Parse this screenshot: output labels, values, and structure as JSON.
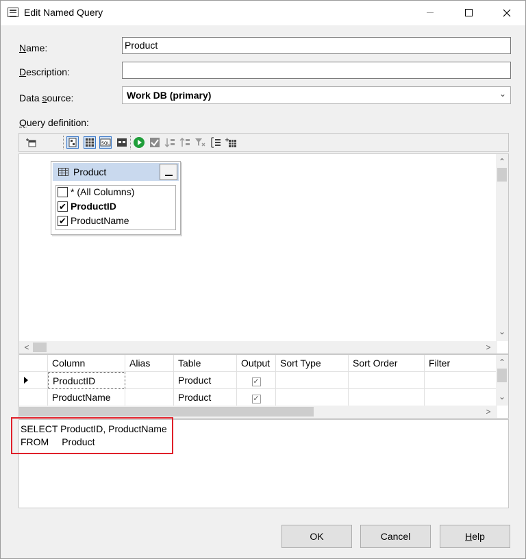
{
  "window": {
    "title": "Edit Named Query"
  },
  "form": {
    "name_label_accel": "N",
    "name_label_rest": "ame:",
    "name_value": "Product",
    "description_label_accel": "D",
    "description_label_rest": "escription:",
    "description_value": "",
    "datasource_label_pre": "Data ",
    "datasource_label_accel": "s",
    "datasource_label_rest": "ource:",
    "datasource_value": "Work DB (primary)",
    "querydef_label_accel": "Q",
    "querydef_label_rest": "uery definition:"
  },
  "toolbar_icons": [
    "add-table-icon",
    "diagram-pane-icon",
    "grid-pane-icon",
    "sql-pane-icon",
    "results-pane-icon",
    "run-icon",
    "verify-sql-icon",
    "sort-ascending-icon",
    "sort-descending-icon",
    "filter-icon",
    "group-by-icon",
    "add-table-alt-icon"
  ],
  "diagram": {
    "table_name": "Product",
    "columns": [
      {
        "label": "* (All Columns)",
        "checked": false
      },
      {
        "label": "ProductID",
        "checked": true,
        "bold": true
      },
      {
        "label": "ProductName",
        "checked": true
      }
    ]
  },
  "grid": {
    "headers": [
      "Column",
      "Alias",
      "Table",
      "Output",
      "Sort Type",
      "Sort Order",
      "Filter"
    ],
    "rows": [
      {
        "column": "ProductID",
        "alias": "",
        "table": "Product",
        "output": true,
        "current": true
      },
      {
        "column": "ProductName",
        "alias": "",
        "table": "Product",
        "output": true,
        "current": false
      }
    ]
  },
  "sql": {
    "line1": "SELECT ProductID, ProductName",
    "line2_kw": "FROM",
    "line2_tbl": "Product"
  },
  "buttons": {
    "ok": "OK",
    "cancel": "Cancel",
    "help_accel": "H",
    "help_rest": "elp"
  },
  "colors": {
    "highlight": "#e0202a",
    "table_header": "#c9d9ee",
    "run_green": "#1f9e3a"
  }
}
